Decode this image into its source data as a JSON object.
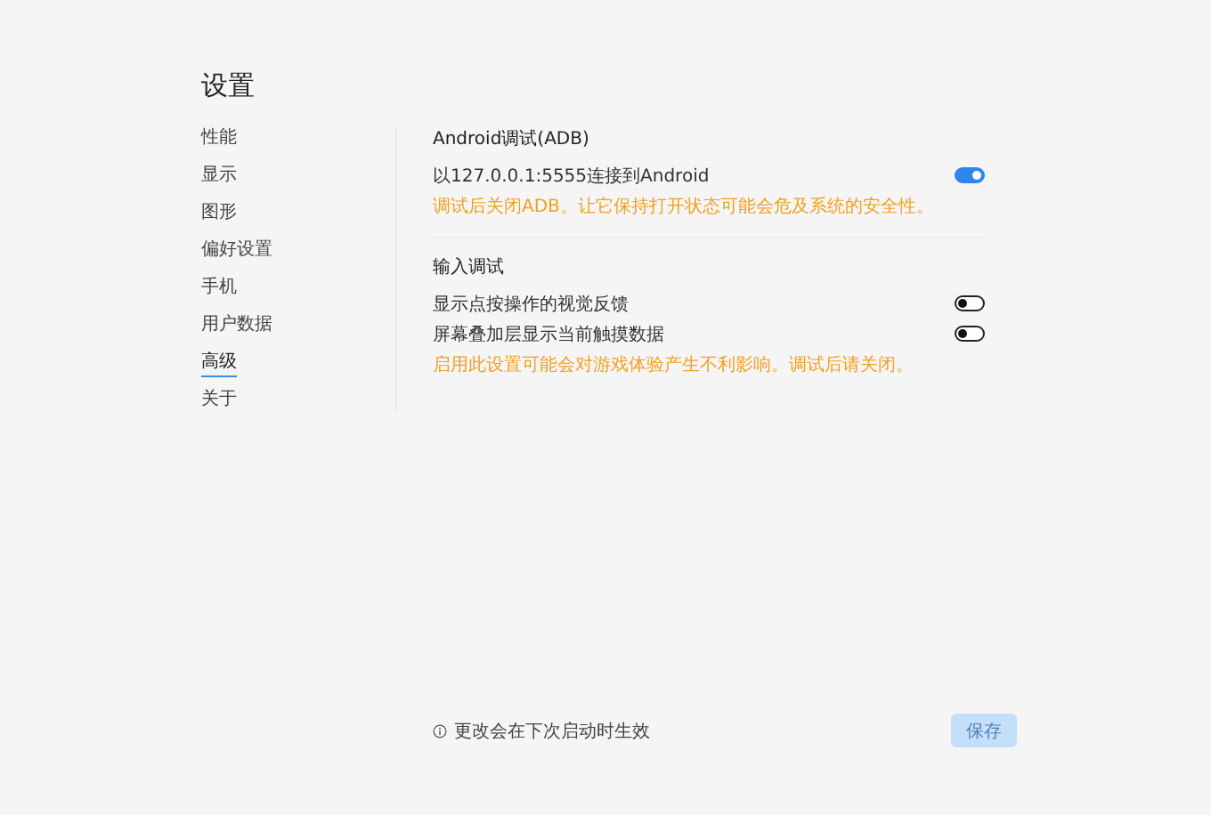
{
  "title": "设置",
  "sidebar": {
    "items": [
      {
        "label": "性能",
        "selected": false
      },
      {
        "label": "显示",
        "selected": false
      },
      {
        "label": "图形",
        "selected": false
      },
      {
        "label": "偏好设置",
        "selected": false
      },
      {
        "label": "手机",
        "selected": false
      },
      {
        "label": "用户数据",
        "selected": false
      },
      {
        "label": "高级",
        "selected": true
      },
      {
        "label": "关于",
        "selected": false
      }
    ]
  },
  "sections": [
    {
      "title": "Android调试(ADB)",
      "rows": [
        {
          "label": "以127.0.0.1:5555连接到Android",
          "on": true
        }
      ],
      "warning": "调试后关闭ADB。让它保持打开状态可能会危及系统的安全性。"
    },
    {
      "title": "输入调试",
      "rows": [
        {
          "label": "显示点按操作的视觉反馈",
          "on": false
        },
        {
          "label": "屏幕叠加层显示当前触摸数据",
          "on": false
        }
      ],
      "warning": "启用此设置可能会对游戏体验产生不利影响。调试后请关闭。"
    }
  ],
  "footer": {
    "note": "更改会在下次启动时生效",
    "save_button": {
      "label": "保存",
      "disabled": true
    }
  }
}
